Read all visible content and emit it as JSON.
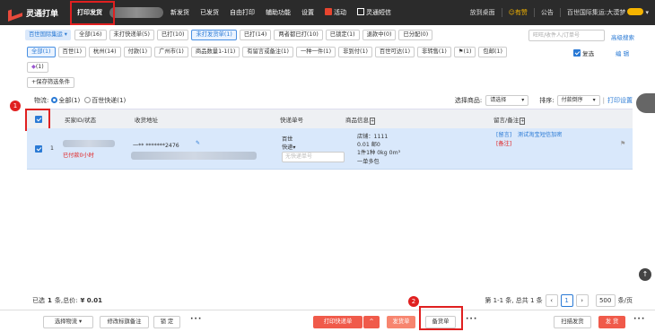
{
  "app": {
    "title": "灵通打单"
  },
  "nav": {
    "items": [
      {
        "label": "打印发货",
        "active": true
      },
      {
        "label": "新发货"
      },
      {
        "label": "已发货"
      },
      {
        "label": "自由打印"
      },
      {
        "label": "辅助功能"
      },
      {
        "label": "设置"
      },
      {
        "label": "活动"
      },
      {
        "label": "灵通短信"
      }
    ],
    "right": [
      "放到桌面",
      "有赞",
      "公告",
      "百世国际集运:大漠梦"
    ]
  },
  "filters": {
    "shop_select": "百世国际集运",
    "tabs": [
      "全部(16)",
      "未打快递单(5)",
      "已打(10)",
      "未打发货单(1)",
      "已打(14)",
      "两者都已打(10)",
      "已锁定(1)",
      "退款中(0)",
      "已分配(0)"
    ],
    "selected_tab": "未打发货单(1)",
    "search_placeholder": "旺旺/收件人/订单号",
    "advanced_search": "高级搜索",
    "merge_label": "复选",
    "edit_label": "编 辑",
    "row2": [
      "全部(1)",
      "百世(1)",
      "杭州(14)",
      "付款(1)",
      "广州市(1)",
      "商品数量1-1(1)",
      "有留言或备注(1)",
      "一种一件(1)",
      "非到付(1)",
      "百世可达(1)",
      "非转售(1)",
      "(1)",
      "包邮(1)"
    ],
    "row3_tag": "(1)",
    "save_filter": "+保存筛选条件"
  },
  "toolbar": {
    "logistics_label": "物流:",
    "radio_all": "全部(1)",
    "radio_baishi": "百世快递(1)",
    "select_goods_label": "选择商品:",
    "select_goods_value": "请选择",
    "sort_label": "排序:",
    "sort_value": "付款倒序",
    "print_settings": "打印设置"
  },
  "table": {
    "headers": [
      "买家ID/状态",
      "收货地址",
      "快递单号",
      "商品信息",
      "留言/备注"
    ],
    "row": {
      "index": "1",
      "status": "已付款0小时",
      "address": "一** *******2476",
      "express_company": "百世",
      "express_type": "快递",
      "tracking_placeholder": "无快递单号",
      "goods_line1": "店铺：1111",
      "goods_line2": "0.01  邮0",
      "goods_line3": "1件1种   0kg   0m³",
      "goods_link": "一单多包",
      "message_tag": "[留言]",
      "message_text": "测试淘宝短信加密",
      "remark_tag": "[备注]"
    }
  },
  "statusbar": {
    "selected_prefix": "已选",
    "selected_count": "1",
    "selected_unit": "条,总价:",
    "total": "¥ 0.01",
    "page_info": "第 1-1 条, 总共 1 条",
    "current_page": "1",
    "page_size": "500",
    "page_size_unit": "条/页"
  },
  "bottom": {
    "select_logistics": "选择物流",
    "edit_remark": "修改标旗备注",
    "lock": "锁 定",
    "print_express": "打印快递单",
    "ship_doc": "发货单",
    "stock_doc": "备货单",
    "scan_ship": "扫描发货",
    "ship": "发 货"
  },
  "annotations": {
    "badge1": "1",
    "badge2": "2"
  },
  "colors": {
    "accent": "#2a7ad5",
    "danger": "#e02020",
    "topbar": "#2b2b2b",
    "row_selected": "#d9e8fb"
  }
}
